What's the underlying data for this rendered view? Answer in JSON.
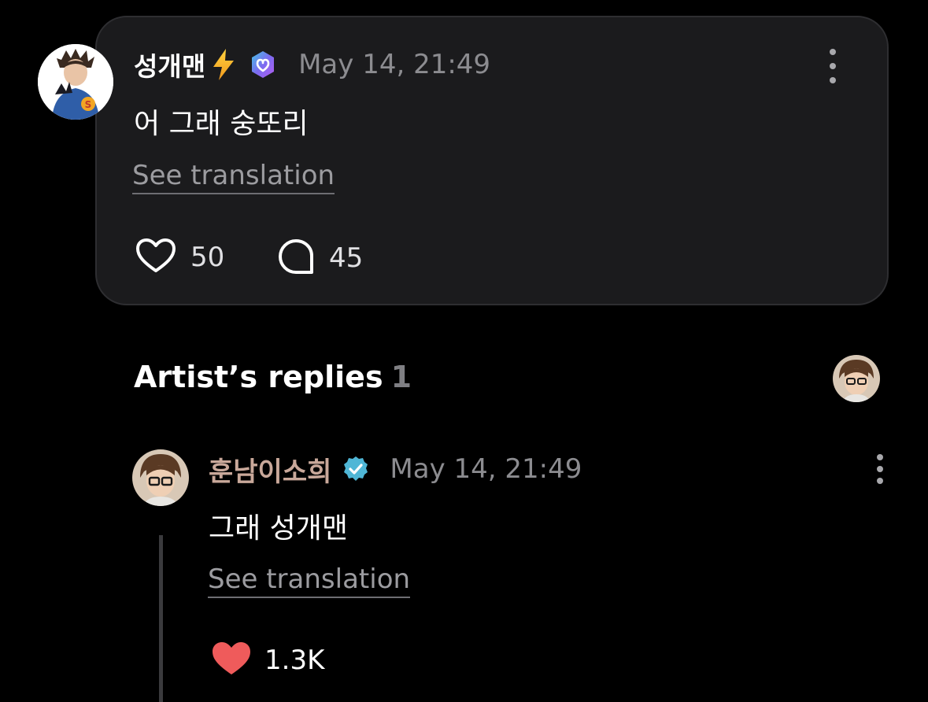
{
  "post": {
    "username": "성개맨",
    "timestamp": "May 14, 21:49",
    "text": "어 그래 숭또리",
    "see_translation": "See translation",
    "likes": "50",
    "comments": "45",
    "icons": {
      "bolt": "lightning-bolt-icon",
      "badge": "verified-membership-badge-icon",
      "more": "more-vertical-icon",
      "like": "heart-outline-icon",
      "comment": "comment-bubble-icon"
    }
  },
  "artist_replies": {
    "title": "Artist’s replies",
    "count": "1"
  },
  "reply": {
    "username": "훈남이소희",
    "timestamp": "May 14, 21:49",
    "text": "그래 성개맨",
    "see_translation": "See translation",
    "likes": "1.3K",
    "icons": {
      "badge": "verified-check-icon",
      "more": "more-vertical-icon",
      "like": "heart-filled-icon"
    }
  },
  "colors": {
    "background": "#000000",
    "card": "#1b1b1d",
    "timestamp": "#8c8c90",
    "artist_name": "#c9a89a",
    "liked_heart": "#ef5b5b",
    "verified_badge": "#4fb6d6"
  }
}
